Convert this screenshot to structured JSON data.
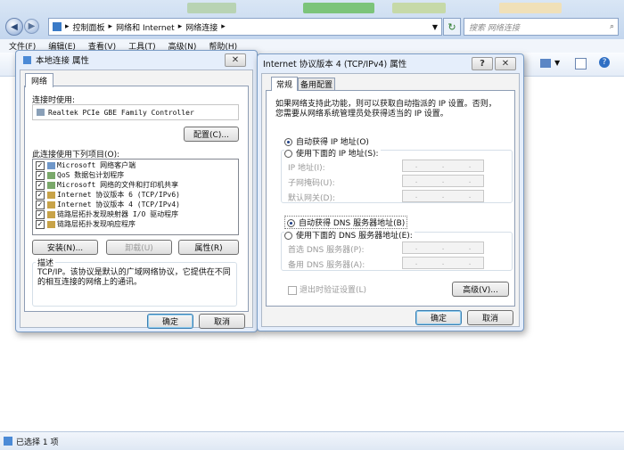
{
  "explorer": {
    "breadcrumb": [
      "控制面板",
      "网络和 Internet",
      "网络连接"
    ],
    "search_placeholder": "搜索 网络连接",
    "menu": [
      "文件(F)",
      "编辑(E)",
      "查看(V)",
      "工具(T)",
      "高级(N)",
      "帮助(H)"
    ],
    "status": "已选择 1 项"
  },
  "local_props": {
    "title": "本地连接 属性",
    "tab_network": "网络",
    "connect_using_label": "连接时使用:",
    "adapter": "Realtek PCIe GBE Family Controller",
    "configure_button": "配置(C)...",
    "items_label": "此连接使用下列项目(O):",
    "items": [
      "Microsoft 网络客户端",
      "QoS 数据包计划程序",
      "Microsoft 网络的文件和打印机共享",
      "Internet 协议版本 6 (TCP/IPv6)",
      "Internet 协议版本 4 (TCP/IPv4)",
      "链路层拓扑发现映射器 I/O 驱动程序",
      "链路层拓扑发现响应程序"
    ],
    "install_button": "安装(N)...",
    "uninstall_button": "卸载(U)",
    "properties_button": "属性(R)",
    "description_title": "描述",
    "description": "TCP/IP。该协议是默认的广域网络协议，它提供在不同的相互连接的网络上的通讯。",
    "ok_button": "确定",
    "cancel_button": "取消"
  },
  "ipv4_props": {
    "title": "Internet 协议版本 4 (TCP/IPv4) 属性",
    "tab_general": "常规",
    "tab_alternate": "备用配置",
    "info_line1": "如果网络支持此功能，则可以获取自动指派的 IP 设置。否则，",
    "info_line2": "您需要从网络系统管理员处获得适当的 IP 设置。",
    "auto_ip": "自动获得 IP 地址(O)",
    "manual_ip": "使用下面的 IP 地址(S):",
    "ip_address": "IP 地址(I):",
    "subnet_mask": "子网掩码(U):",
    "gateway": "默认网关(D):",
    "auto_dns": "自动获得 DNS 服务器地址(B)",
    "manual_dns": "使用下面的 DNS 服务器地址(E):",
    "preferred_dns": "首选 DNS 服务器(P):",
    "alternate_dns": "备用 DNS 服务器(A):",
    "validate_on_exit": "退出时验证设置(L)",
    "advanced_button": "高级(V)...",
    "ok_button": "确定",
    "cancel_button": "取消"
  },
  "icons": {
    "back": "back-arrow-icon",
    "forward": "forward-arrow-icon",
    "refresh": "refresh-icon",
    "search": "search-icon"
  }
}
